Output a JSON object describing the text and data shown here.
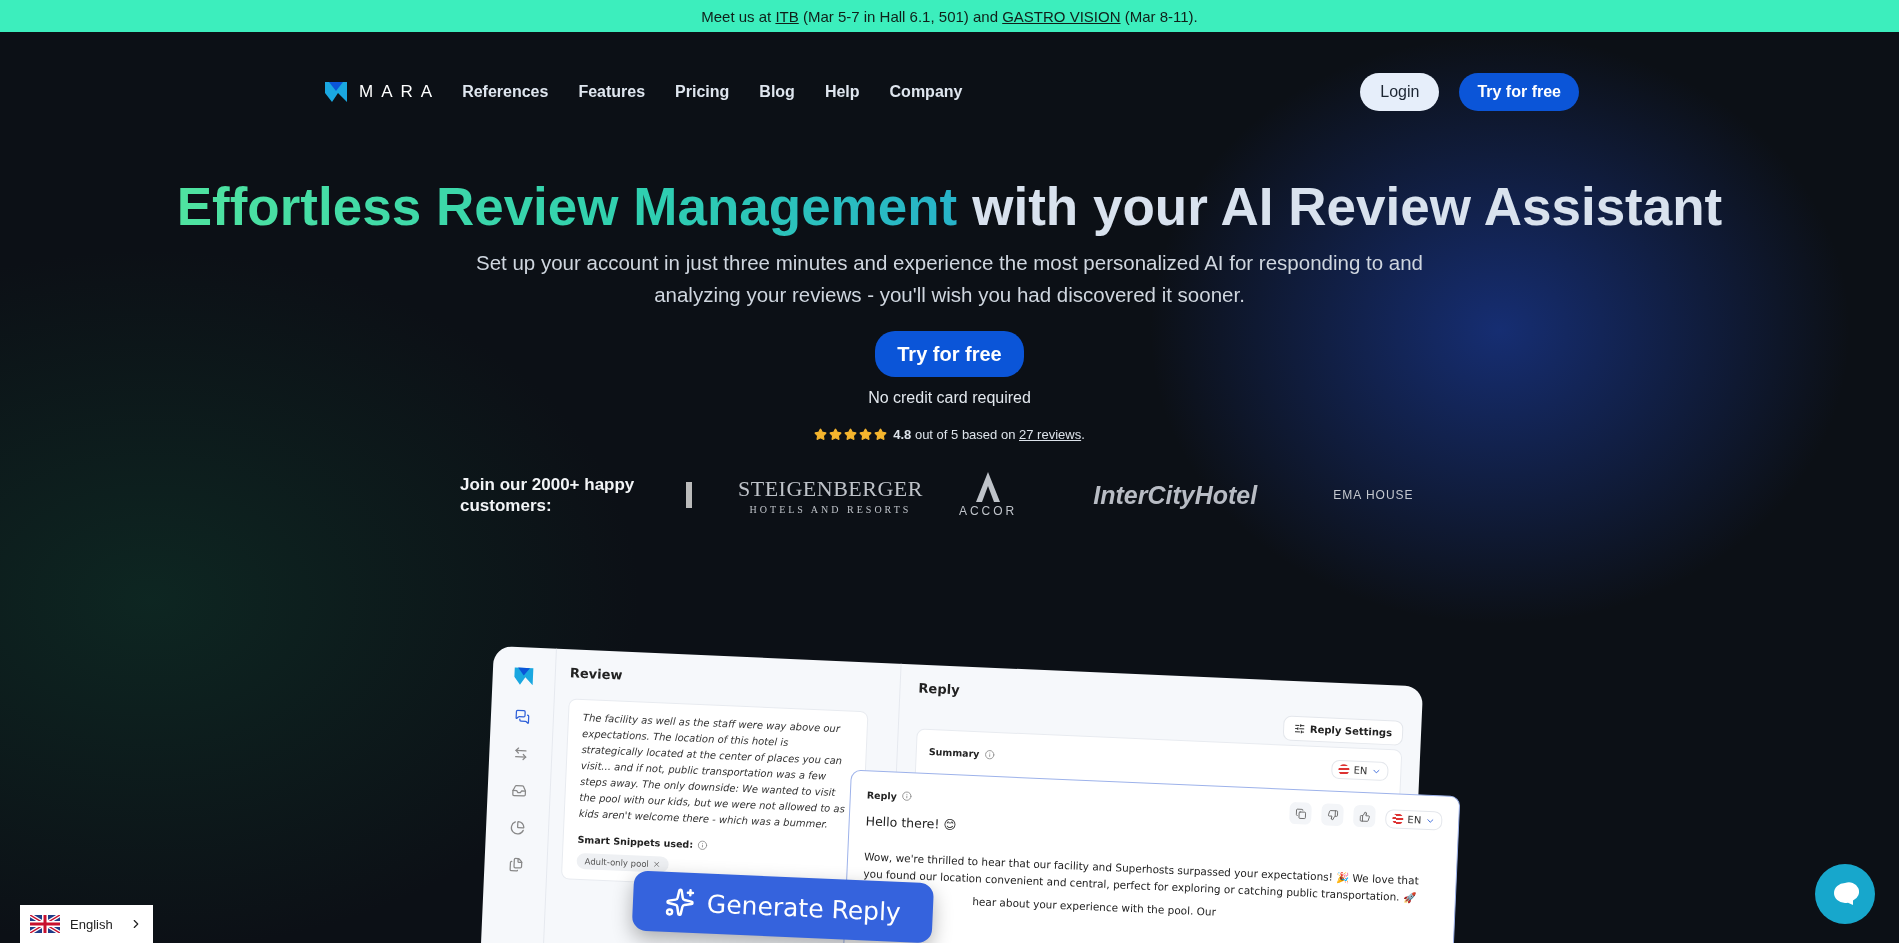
{
  "announcement": {
    "parts": [
      {
        "kind": "text",
        "text": "Meet us at "
      },
      {
        "kind": "link",
        "text": "ITB"
      },
      {
        "kind": "text",
        "text": " (Mar 5-7 in Hall 6.1, 501) and "
      },
      {
        "kind": "link",
        "text": "GASTRO VISION"
      },
      {
        "kind": "text",
        "text": " (Mar 8-11)."
      }
    ]
  },
  "nav": {
    "logo": "MARA",
    "links": [
      "References",
      "Features",
      "Pricing",
      "Blog",
      "Help",
      "Company"
    ],
    "login": "Login",
    "cta": "Try for free"
  },
  "hero": {
    "title_highlight": "Effortless Review Management",
    "title_rest": "with your AI Review Assistant",
    "subtitle": "Set up your account in just three minutes and experience the most personalized AI for responding to and analyzing your reviews - you'll wish you had discovered it sooner.",
    "cta": "Try for free",
    "note": "No credit card required",
    "rating": {
      "stars": 5,
      "score": "4.8",
      "text": " out of 5 based on ",
      "link": "27 reviews",
      "end": "."
    }
  },
  "customers": {
    "label": "Join our 2000+ happy customers:",
    "logos": [
      {
        "kind": "steigenberger",
        "name": "STEIGENBERGER",
        "sub": "HOTELS AND RESORTS"
      },
      {
        "kind": "accor",
        "name": "ACCOR"
      },
      {
        "kind": "intercity",
        "name": "InterCityHotel"
      },
      {
        "kind": "ema",
        "name": "EMA HOUSE"
      }
    ]
  },
  "mockup": {
    "review_title": "Review",
    "review_text": "The facility as well as the staff were way above our expectations. The location of this hotel is strategically located at the center of places you can visit... and if not, public transportation was a few steps away. The only downside: We wanted to visit the pool with our kids, but we were not allowed to as kids aren't welcome there - which was a bummer.",
    "snippets_label": "Smart Snippets used:",
    "snippets": [
      "Adult-only pool"
    ],
    "reply_title": "Reply",
    "reply_settings": "Reply Settings",
    "summary_label": "Summary",
    "summary_lang": "EN",
    "reply_label": "Reply",
    "reply_lang": "EN",
    "greeting": "Hello there! 😊",
    "reply_text": "Wow, we're thrilled to hear that our facility and Superhosts surpassed your expectations! 🎉 We love that you found our location convenient and central, perfect for exploring or catching public transportation. 🚀",
    "reply_cut": "hear about your experience with the pool. Our",
    "generate": "Generate Reply"
  },
  "language": {
    "label": "English"
  }
}
